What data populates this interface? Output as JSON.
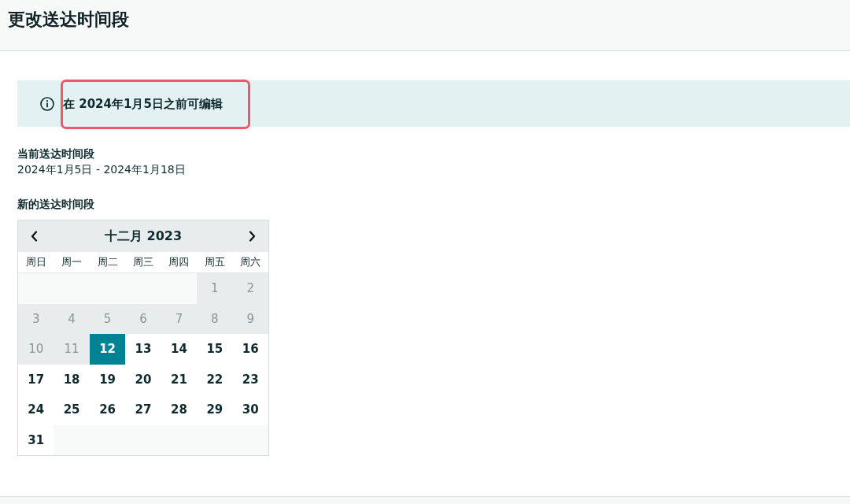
{
  "header": {
    "title": "更改送达时间段"
  },
  "notice": {
    "text": "在 2024年1月5日之前可编辑",
    "highlighted": true
  },
  "current_window": {
    "label": "当前送达时间段",
    "value": "2024年1月5日 - 2024年1月18日"
  },
  "new_window": {
    "label": "新的送达时间段"
  },
  "calendar": {
    "month": "十二月 2023",
    "weekdays": [
      "周日",
      "周一",
      "周二",
      "周三",
      "周四",
      "周五",
      "周六"
    ],
    "weeks": [
      [
        {
          "kind": "blank"
        },
        {
          "kind": "blank"
        },
        {
          "kind": "blank"
        },
        {
          "kind": "blank"
        },
        {
          "kind": "blank"
        },
        {
          "kind": "day",
          "day": "1",
          "disabled": true,
          "selected": false
        },
        {
          "kind": "day",
          "day": "2",
          "disabled": true,
          "selected": false
        }
      ],
      [
        {
          "kind": "day",
          "day": "3",
          "disabled": true,
          "selected": false
        },
        {
          "kind": "day",
          "day": "4",
          "disabled": true,
          "selected": false
        },
        {
          "kind": "day",
          "day": "5",
          "disabled": true,
          "selected": false
        },
        {
          "kind": "day",
          "day": "6",
          "disabled": true,
          "selected": false
        },
        {
          "kind": "day",
          "day": "7",
          "disabled": true,
          "selected": false
        },
        {
          "kind": "day",
          "day": "8",
          "disabled": true,
          "selected": false
        },
        {
          "kind": "day",
          "day": "9",
          "disabled": true,
          "selected": false
        }
      ],
      [
        {
          "kind": "day",
          "day": "10",
          "disabled": true,
          "selected": false
        },
        {
          "kind": "day",
          "day": "11",
          "disabled": true,
          "selected": false
        },
        {
          "kind": "day",
          "day": "12",
          "disabled": false,
          "selected": true
        },
        {
          "kind": "day",
          "day": "13",
          "disabled": false,
          "selected": false
        },
        {
          "kind": "day",
          "day": "14",
          "disabled": false,
          "selected": false
        },
        {
          "kind": "day",
          "day": "15",
          "disabled": false,
          "selected": false
        },
        {
          "kind": "day",
          "day": "16",
          "disabled": false,
          "selected": false
        }
      ],
      [
        {
          "kind": "day",
          "day": "17",
          "disabled": false,
          "selected": false
        },
        {
          "kind": "day",
          "day": "18",
          "disabled": false,
          "selected": false
        },
        {
          "kind": "day",
          "day": "19",
          "disabled": false,
          "selected": false
        },
        {
          "kind": "day",
          "day": "20",
          "disabled": false,
          "selected": false
        },
        {
          "kind": "day",
          "day": "21",
          "disabled": false,
          "selected": false
        },
        {
          "kind": "day",
          "day": "22",
          "disabled": false,
          "selected": false
        },
        {
          "kind": "day",
          "day": "23",
          "disabled": false,
          "selected": false
        }
      ],
      [
        {
          "kind": "day",
          "day": "24",
          "disabled": false,
          "selected": false
        },
        {
          "kind": "day",
          "day": "25",
          "disabled": false,
          "selected": false
        },
        {
          "kind": "day",
          "day": "26",
          "disabled": false,
          "selected": false
        },
        {
          "kind": "day",
          "day": "27",
          "disabled": false,
          "selected": false
        },
        {
          "kind": "day",
          "day": "28",
          "disabled": false,
          "selected": false
        },
        {
          "kind": "day",
          "day": "29",
          "disabled": false,
          "selected": false
        },
        {
          "kind": "day",
          "day": "30",
          "disabled": false,
          "selected": false
        }
      ],
      [
        {
          "kind": "day",
          "day": "31",
          "disabled": false,
          "selected": false
        },
        {
          "kind": "blank"
        },
        {
          "kind": "blank"
        },
        {
          "kind": "blank"
        },
        {
          "kind": "blank"
        },
        {
          "kind": "blank"
        },
        {
          "kind": "blank"
        }
      ]
    ]
  }
}
